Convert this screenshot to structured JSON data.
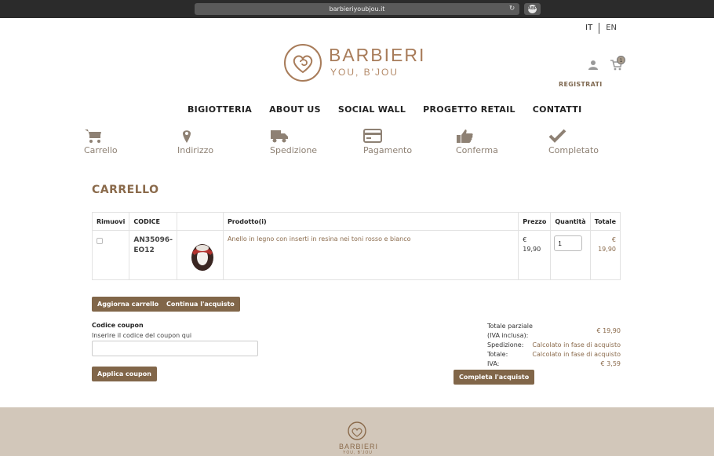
{
  "browser": {
    "url": "barbieriyoubjou.it",
    "reload_icon": "reload-icon",
    "extension_icon": "adblock-icon",
    "extension_label": "ABP"
  },
  "header": {
    "lang": [
      "IT",
      "EN"
    ],
    "brand_name": "BARBIERI",
    "brand_tagline": "YOU, B'JOU",
    "cart_count": "1",
    "register_label": "REGISTRATI"
  },
  "nav": [
    "BIGIOTTERIA",
    "ABOUT US",
    "SOCIAL WALL",
    "PROGETTO RETAIL",
    "CONTATTI"
  ],
  "steps": [
    {
      "label": "Carrello",
      "icon": "cart-icon"
    },
    {
      "label": "Indirizzo",
      "icon": "map-pin-icon"
    },
    {
      "label": "Spedizione",
      "icon": "truck-icon"
    },
    {
      "label": "Pagamento",
      "icon": "credit-card-icon"
    },
    {
      "label": "Conferma",
      "icon": "thumbs-up-icon"
    },
    {
      "label": "Completato",
      "icon": "checkmark-icon"
    }
  ],
  "page_title": "CARRELLO",
  "table": {
    "headers": [
      "Rimuovi",
      "CODICE",
      "",
      "Prodotto(i)",
      "Prezzo",
      "Quantità",
      "Totale"
    ],
    "rows": [
      {
        "code": "AN35096-EO12",
        "code_line1": "AN35096-",
        "code_line2": "EO12",
        "product": "Anello in legno con inserti in resina nei toni rosso e bianco",
        "price_currency": "€",
        "price_value": "19,90",
        "quantity": "1",
        "total_currency": "€",
        "total_value": "19,90"
      }
    ]
  },
  "buttons": {
    "update_cart": "Aggiorna carrello",
    "continue_shopping": "Continua l'acquisto",
    "apply_coupon": "Applica coupon",
    "checkout": "Completa l'acquisto"
  },
  "coupon": {
    "title": "Codice coupon",
    "hint": "Inserire il codice del coupon qui",
    "value": ""
  },
  "totals": {
    "subtotal_label_1": "Totale parziale",
    "subtotal_label_2": "(IVA inclusa):",
    "subtotal_value": "€ 19,90",
    "shipping_label": "Spedizione:",
    "shipping_value": "Calcolato in fase di acquisto",
    "total_label": "Totale:",
    "total_value": "Calcolato in fase di acquisto",
    "vat_label": "IVA:",
    "vat_value": "€ 3,59"
  },
  "footer": {
    "brand_name": "BARBIERI",
    "brand_tagline": "YOU, B'JOU"
  },
  "colors": {
    "brand": "#a87c5a",
    "button": "#816649",
    "footer_bg": "#d2c7ba",
    "step_grey": "#8e8174"
  }
}
